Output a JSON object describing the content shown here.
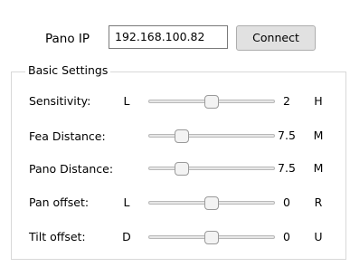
{
  "connection": {
    "ip_label": "Pano IP",
    "ip_value": "192.168.100.82",
    "connect_label": "Connect"
  },
  "basic_settings": {
    "title": "Basic Settings",
    "sliders": [
      {
        "label": "Sensitivity:",
        "min_label": "L",
        "value": "2",
        "max_label": "H",
        "level": 0.5
      },
      {
        "label": "Fea Distance:",
        "min_label": "",
        "value": "7.5",
        "max_label": "M",
        "level": 0.23
      },
      {
        "label": "Pano Distance:",
        "min_label": "",
        "value": "7.5",
        "max_label": "M",
        "level": 0.23
      },
      {
        "label": "Pan offset:",
        "min_label": "L",
        "value": "0",
        "max_label": "R",
        "level": 0.5
      },
      {
        "label": "Tilt offset:",
        "min_label": "D",
        "value": "0",
        "max_label": "U",
        "level": 0.5
      }
    ]
  }
}
